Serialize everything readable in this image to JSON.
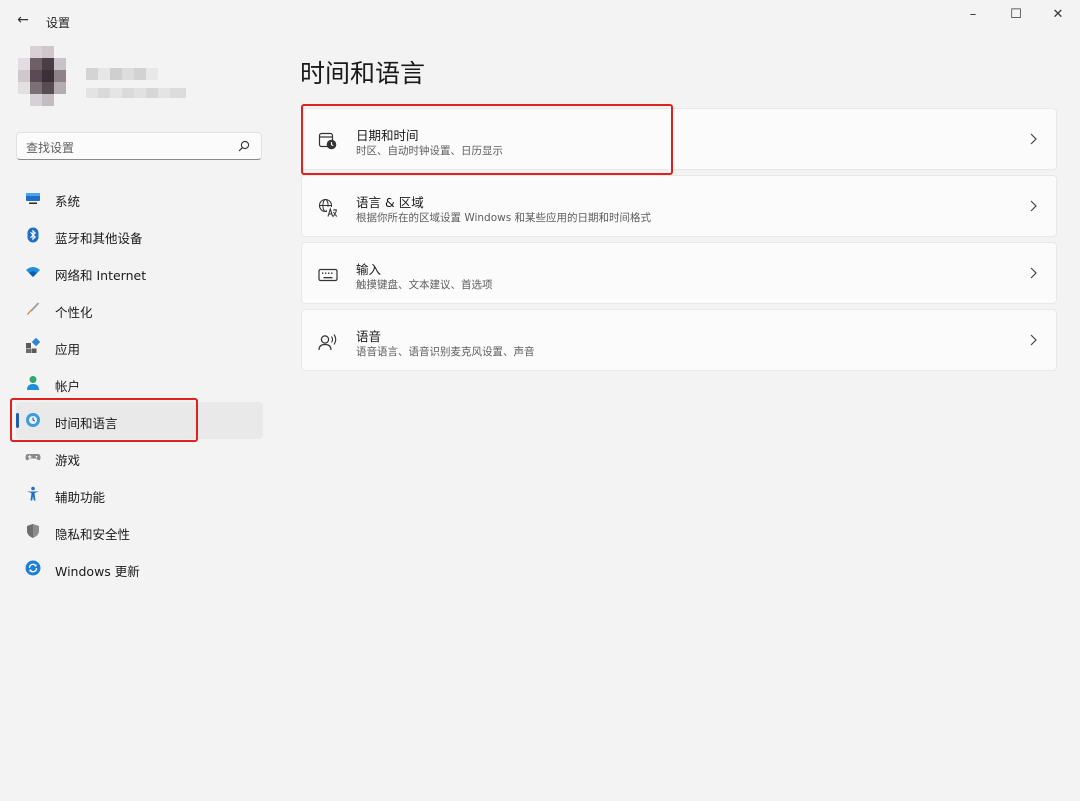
{
  "window": {
    "title": "设置",
    "back_glyph": "←",
    "min_glyph": "–",
    "max_glyph": "☐",
    "close_glyph": "✕"
  },
  "search": {
    "placeholder": "查找设置"
  },
  "sidebar": {
    "items": [
      {
        "label": "系统",
        "icon": "monitor-icon"
      },
      {
        "label": "蓝牙和其他设备",
        "icon": "bluetooth-icon"
      },
      {
        "label": "网络和 Internet",
        "icon": "wifi-icon"
      },
      {
        "label": "个性化",
        "icon": "brush-icon"
      },
      {
        "label": "应用",
        "icon": "apps-icon"
      },
      {
        "label": "帐户",
        "icon": "account-icon"
      },
      {
        "label": "时间和语言",
        "icon": "globe-clock-icon",
        "active": true
      },
      {
        "label": "游戏",
        "icon": "gamepad-icon"
      },
      {
        "label": "辅助功能",
        "icon": "accessibility-icon"
      },
      {
        "label": "隐私和安全性",
        "icon": "shield-icon"
      },
      {
        "label": "Windows 更新",
        "icon": "update-icon"
      }
    ]
  },
  "main": {
    "title": "时间和语言",
    "cards": [
      {
        "title": "日期和时间",
        "subtitle": "时区、自动时钟设置、日历显示",
        "icon": "calendar-clock-icon"
      },
      {
        "title": "语言 & 区域",
        "subtitle": "根据你所在的区域设置 Windows 和某些应用的日期和时间格式",
        "icon": "language-icon"
      },
      {
        "title": "输入",
        "subtitle": "触摸键盘、文本建议、首选项",
        "icon": "keyboard-icon"
      },
      {
        "title": "语音",
        "subtitle": "语音语言、语音识别麦克风设置、声音",
        "icon": "speech-icon"
      }
    ]
  },
  "colors": {
    "accent": "#1f5fa8",
    "highlight": "#e0211e",
    "background": "#f3f3f3",
    "card": "#fbfbfb"
  }
}
